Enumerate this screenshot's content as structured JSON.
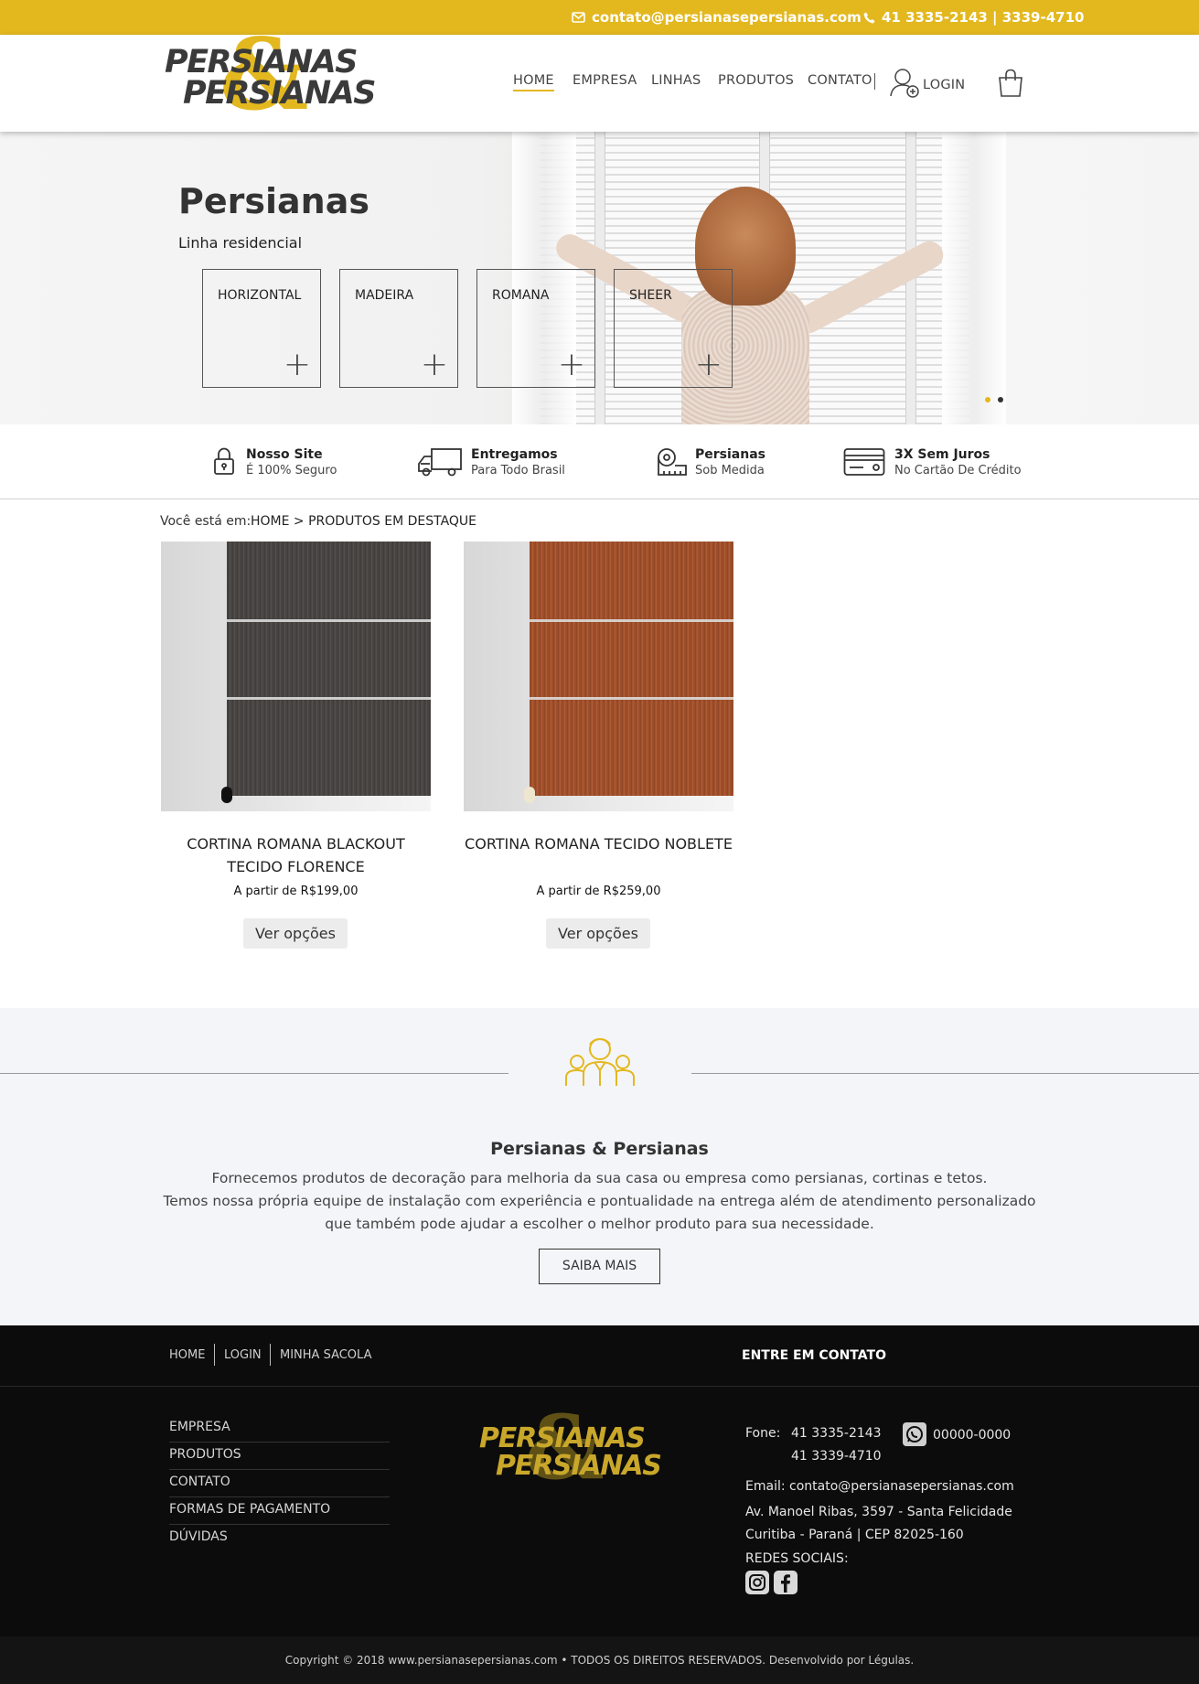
{
  "topbar": {
    "email": "contato@persianasepersianas.com",
    "phone": "41 3335-2143 | 3339-4710",
    "email_icon": "envelope-icon",
    "phone_icon": "phone-icon"
  },
  "brand": {
    "word1": "PERSIANAS",
    "ampersand": "&",
    "word2": "PERSIANAS",
    "colors": {
      "accent": "#e3b81f",
      "dark": "#3a3a3a",
      "footer_bg": "#0c0c0c"
    }
  },
  "nav": {
    "items": [
      "HOME",
      "EMPRESA",
      "LINHAS",
      "PRODUTOS",
      "CONTATO"
    ],
    "active": "HOME",
    "login": "LOGIN",
    "login_icon": "user-add-icon",
    "cart_icon": "shopping-bag-icon"
  },
  "hero": {
    "title": "Persianas",
    "subtitle": "Linha residencial",
    "boxes": [
      "HORIZONTAL",
      "MADEIRA",
      "ROMANA",
      "SHEER"
    ],
    "plus": "+",
    "slides": 2,
    "active_slide": 1
  },
  "features": [
    {
      "icon": "lock-icon",
      "title": "Nosso Site",
      "subtitle": "É 100% Seguro"
    },
    {
      "icon": "truck-icon",
      "title": "Entregamos",
      "subtitle": "Para Todo Brasil"
    },
    {
      "icon": "tape-measure-icon",
      "title": "Persianas",
      "subtitle": "Sob Medida"
    },
    {
      "icon": "credit-card-icon",
      "title": "3X Sem Juros",
      "subtitle": "No Cartão De Crédito"
    }
  ],
  "breadcrumb": {
    "label": "Você está em:",
    "path": "HOME > PRODUTOS EM DESTAQUE"
  },
  "products": [
    {
      "name": "CORTINA ROMANA BLACKOUT TECIDO FLORENCE",
      "price": "A partir de R$199,00",
      "button": "Ver opções",
      "fabric_color": "#4a4644"
    },
    {
      "name": "CORTINA ROMANA TECIDO NOBLETE",
      "price": "A partir de R$259,00",
      "button": "Ver opções",
      "fabric_color": "#a0502a"
    }
  ],
  "about": {
    "icon": "team-people-icon",
    "title": "Persianas & Persianas",
    "line1": "Fornecemos produtos de decoração para melhoria da sua casa ou empresa como persianas, cortinas e tetos.",
    "line2": "Temos nossa própria equipe de instalação com experiência e pontualidade na entrega além de atendimento personalizado que também pode ajudar a escolher o melhor produto para sua necessidade.",
    "button": "SAIBA MAIS"
  },
  "footer": {
    "top_links": [
      "HOME",
      "LOGIN",
      "MINHA SACOLA"
    ],
    "contact_title": "ENTRE EM CONTATO",
    "links": [
      "EMPRESA",
      "PRODUTOS",
      "CONTATO",
      "FORMAS DE PAGAMENTO",
      "DÚVIDAS"
    ],
    "phone_label": "Fone:",
    "phone1": "41 3335-2143",
    "phone2": "41 3339-4710",
    "whatsapp": "00000-0000",
    "whatsapp_icon": "whatsapp-icon",
    "email": "Email: contato@persianasepersianas.com",
    "address1": "Av. Manoel Ribas, 3597 - Santa Felicidade",
    "address2": "Curitiba - Paraná | CEP 82025-160",
    "social_label": "REDES SOCIAIS:",
    "social_icons": [
      "instagram-icon",
      "facebook-icon"
    ],
    "copyright": "Copyright © 2018  www.persianasepersianas.com  • TODOS OS DIREITOS RESERVADOS.   Desenvolvido por Légulas."
  }
}
